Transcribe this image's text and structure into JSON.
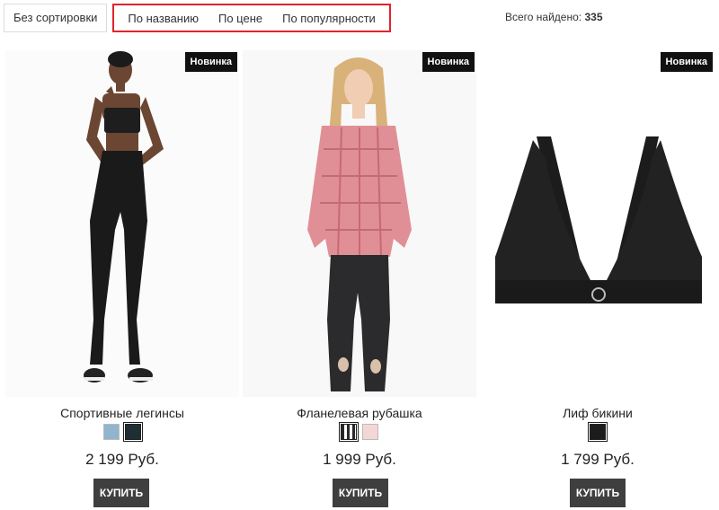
{
  "sort": {
    "default_label": "Без сортировки",
    "options": [
      "По названию",
      "По цене",
      "По популярности"
    ]
  },
  "total": {
    "label": "Всего найдено:",
    "count": "335"
  },
  "colors": {
    "highlight_border": "#e0242b",
    "buy_button": "#3f3f3f",
    "badge": "#111111"
  },
  "products": [
    {
      "badge": "Новинка",
      "name": "Спортивные легинсы",
      "price": "2 199 Руб.",
      "buy_label": "КУПИТЬ",
      "swatches": [
        "#8fb5cf",
        "#1f2e33"
      ]
    },
    {
      "badge": "Новинка",
      "name": "Фланелевая рубашка",
      "price": "1 999 Руб.",
      "buy_label": "КУПИТЬ",
      "swatches": [
        "#2a2a2a",
        "#f5d6d6"
      ]
    },
    {
      "badge": "Новинка",
      "name": "Лиф бикини",
      "price": "1 799 Руб.",
      "buy_label": "КУПИТЬ",
      "swatches": [
        "#1c1c1c"
      ]
    }
  ]
}
